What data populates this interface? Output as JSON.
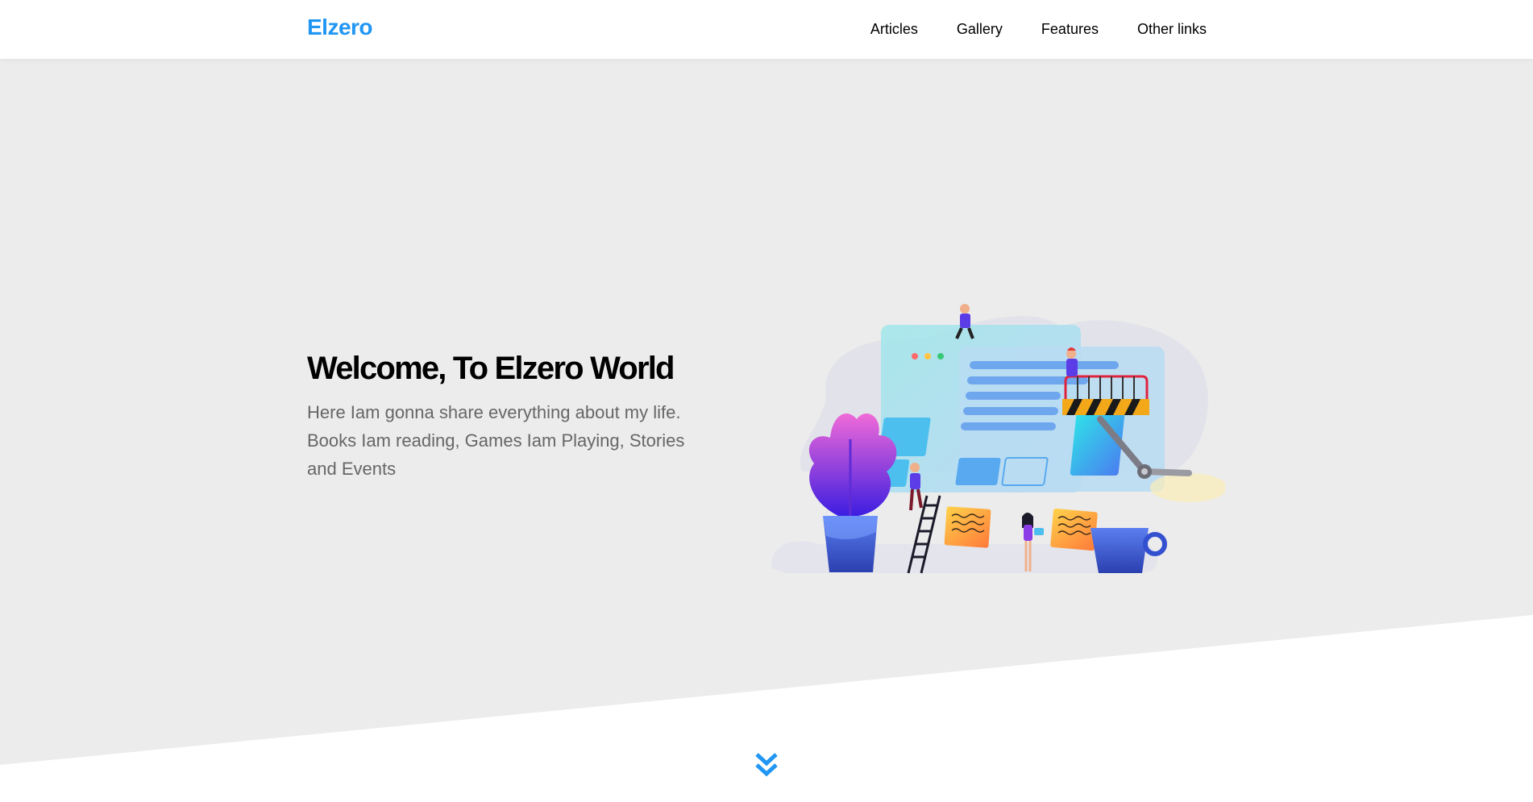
{
  "header": {
    "logo": "Elzero",
    "nav": [
      {
        "label": "Articles"
      },
      {
        "label": "Gallery"
      },
      {
        "label": "Features"
      },
      {
        "label": "Other links"
      }
    ]
  },
  "hero": {
    "title": "Welcome, To Elzero World",
    "description": "Here Iam gonna share everything about my life. Books Iam reading, Games Iam Playing, Stories and Events"
  },
  "colors": {
    "brand": "#2196f3",
    "hero_background": "#ececec",
    "text_muted": "#666666"
  },
  "icons": {
    "go_down": "double-chevron-down-icon"
  }
}
